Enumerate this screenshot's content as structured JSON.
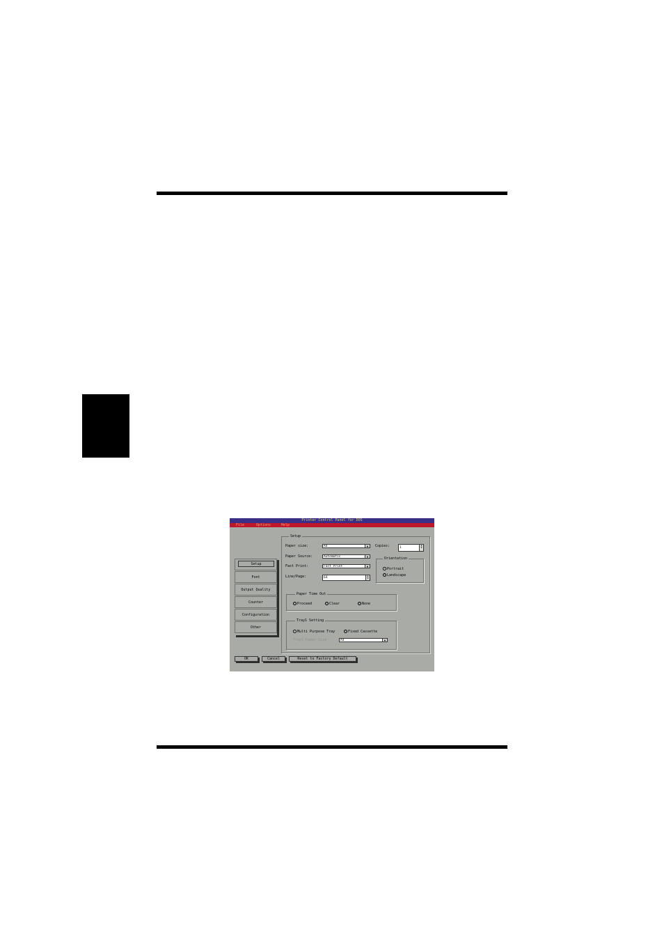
{
  "window": {
    "title": "Printer Control Panel for DOS",
    "menu": [
      "File",
      "Options",
      "Help"
    ]
  },
  "tabs": [
    "Setup",
    "Font",
    "Output Quality",
    "Counter",
    "Configuration",
    "Other"
  ],
  "setup": {
    "legend": "Setup",
    "paper_size_label": "Paper size:",
    "paper_size_value": "A4",
    "paper_source_label": "Paper Source:",
    "paper_source_value": "Automatic",
    "fast_print_label": "Fast Print:",
    "fast_print_value": "Fast Print",
    "line_page_label": "Line/Page:",
    "line_page_value": "64",
    "copies_label": "Copies:",
    "copies_value": "1"
  },
  "orientation": {
    "legend": "Orientation",
    "options": [
      "Portrait",
      "Landscape"
    ],
    "selected": "Portrait"
  },
  "paper_time_out": {
    "legend": "Paper Time Out",
    "options": [
      "Proceed",
      "Clear",
      "None"
    ]
  },
  "tray_setting": {
    "legend": "Tray1 Setting",
    "options": [
      "Multi Purpose Tray",
      "Fixed Cassette"
    ],
    "selected": "Multi Purpose Tray",
    "tray_paper_size_label": "Tray1 Paper Size",
    "tray_paper_size_value": "A4"
  },
  "buttons": {
    "ok": "OK",
    "cancel": "Cancel",
    "reset": "Reset to Factory Default"
  },
  "colors": {
    "titlebar": "#3a2f86",
    "menubar": "#c0162b",
    "window_bg": "#a9aca6"
  }
}
